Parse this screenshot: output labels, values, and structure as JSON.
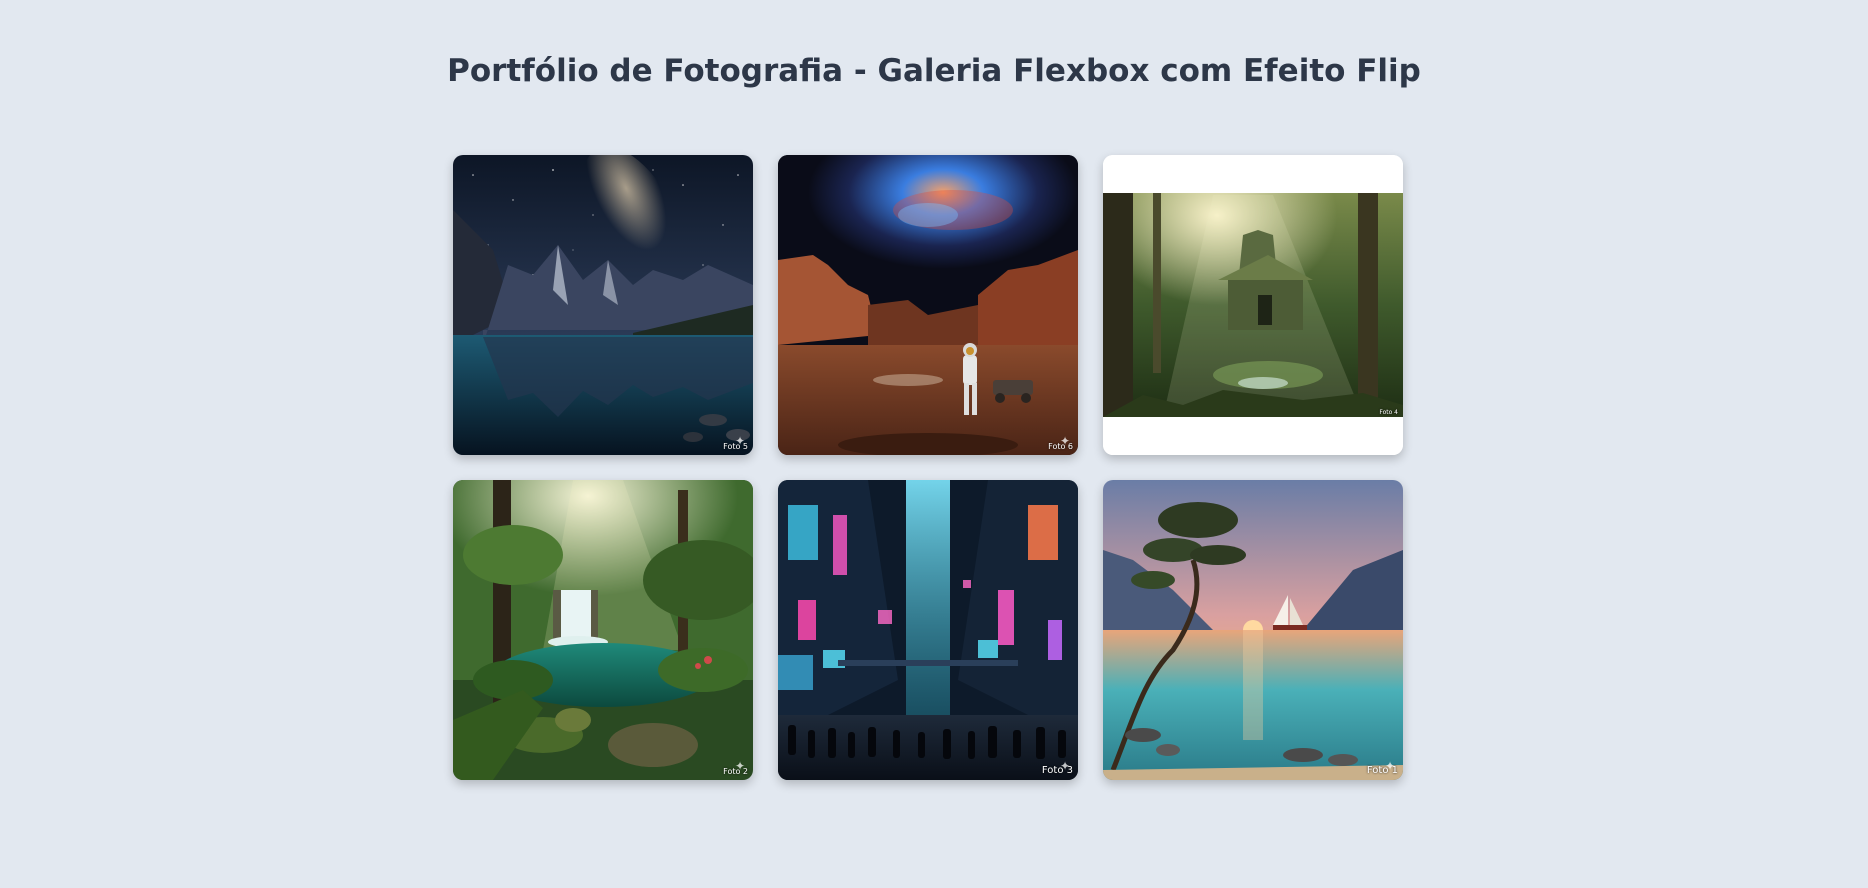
{
  "page": {
    "title": "Portfólio de Fotografia - Galeria Flexbox com Efeito Flip",
    "background": "#e2e8f0",
    "title_color": "#2d3748"
  },
  "gallery": {
    "cards": [
      {
        "caption": "Foto 5",
        "subject": "mountain lake under milky way",
        "icon": "sparkle-icon"
      },
      {
        "caption": "Foto 6",
        "subject": "astronaut in red canyon under nebula",
        "icon": "sparkle-icon"
      },
      {
        "caption": "Foto 4",
        "subject": "mossy temple in sunlit forest"
      },
      {
        "caption": "Foto 2",
        "subject": "jungle waterfall with green pool",
        "icon": "sparkle-icon"
      },
      {
        "caption": "Foto 3",
        "subject": "neon cyberpunk city street",
        "icon": "sparkle-icon"
      },
      {
        "caption": "Foto 1",
        "subject": "sunset lake with pine tree and sailboat",
        "icon": "sparkle-icon"
      }
    ]
  }
}
